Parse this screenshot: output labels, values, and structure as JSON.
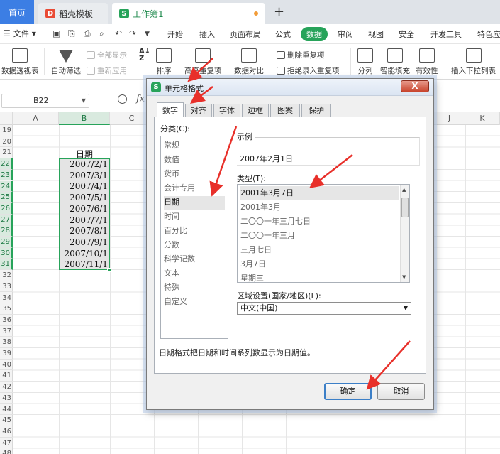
{
  "tabs": {
    "home": "首页",
    "docer": "稻壳模板",
    "docer_logo": "D",
    "workbook": "工作簿1",
    "workbook_logo": "S",
    "new_tab": "+"
  },
  "menu": {
    "file": "文件",
    "items": [
      "开始",
      "插入",
      "页面布局",
      "公式",
      "数据",
      "审阅",
      "视图",
      "安全",
      "开发工具",
      "特色应"
    ]
  },
  "ribbon": {
    "pivot": "数据透视表",
    "auto_filter": "自动筛选",
    "show_all": "全部显示",
    "reapply": "重新应用",
    "sort": "排序",
    "highlight_dup": "高亮重复项",
    "compare": "数据对比",
    "remove_dup": "删除重复项",
    "reject_dup": "拒绝录入重复项",
    "split": "分列",
    "smart_fill": "智能填充",
    "validity": "有效性",
    "dropdown": "插入下拉列表"
  },
  "formula_bar": {
    "name_box": "B22",
    "fx": "fx"
  },
  "grid": {
    "columns": [
      "A",
      "B",
      "C",
      "",
      "",
      "",
      "",
      "",
      "",
      "J",
      "K"
    ],
    "rows": [
      "19",
      "20",
      "21",
      "22",
      "23",
      "24",
      "25",
      "26",
      "27",
      "28",
      "29",
      "30",
      "31",
      "32",
      "33",
      "34",
      "35",
      "36",
      "37",
      "38",
      "39",
      "40",
      "41",
      "42",
      "43",
      "44",
      "45",
      "46",
      "47",
      "48"
    ],
    "header_cell": "日期",
    "dates": [
      "2007/2/1",
      "2007/3/1",
      "2007/4/1",
      "2007/5/1",
      "2007/6/1",
      "2007/7/1",
      "2007/8/1",
      "2007/9/1",
      "2007/10/1",
      "2007/11/1"
    ]
  },
  "dialog": {
    "title": "单元格格式",
    "logo": "S",
    "close": "X",
    "tabs": [
      "数字",
      "对齐",
      "字体",
      "边框",
      "图案",
      "保护"
    ],
    "category_label": "分类(C):",
    "categories": [
      "常规",
      "数值",
      "货币",
      "会计专用",
      "日期",
      "时间",
      "百分比",
      "分数",
      "科学记数",
      "文本",
      "特殊",
      "自定义"
    ],
    "selected_category": "日期",
    "sample_label": "示例",
    "sample_value": "2007年2月1日",
    "type_label": "类型(T):",
    "types": [
      "2001年3月7日",
      "2001年3月",
      "二〇〇一年三月七日",
      "二〇〇一年三月",
      "三月七日",
      "3月7日",
      "星期三"
    ],
    "selected_type": "2001年3月7日",
    "locale_label": "区域设置(国家/地区)(L):",
    "locale_value": "中文(中国)",
    "description": "日期格式把日期和时间系列数显示为日期值。",
    "ok": "确定",
    "cancel": "取消"
  },
  "colors": {
    "accent_green": "#27a35a",
    "tab_blue": "#3c7ee4",
    "annotation_red": "#e8302a"
  }
}
